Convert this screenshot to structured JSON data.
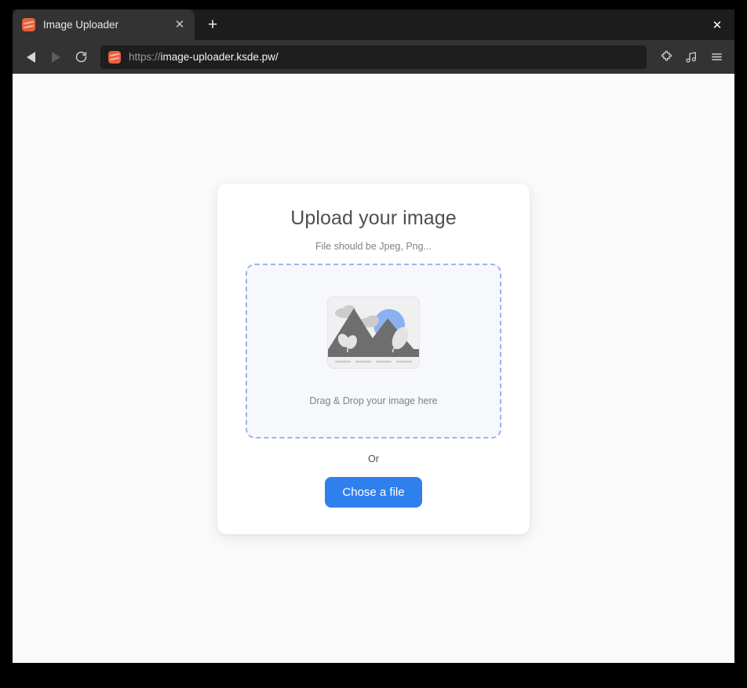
{
  "window": {
    "close_label": "✕"
  },
  "tabs": [
    {
      "title": "Image Uploader",
      "favicon_name": "image-uploader-favicon",
      "close_label": "✕"
    }
  ],
  "new_tab": {
    "label": "+"
  },
  "toolbar": {
    "back_icon": "back-arrow-icon",
    "forward_icon": "forward-arrow-icon",
    "reload_icon": "reload-icon",
    "extensions_icon": "puzzle-piece-icon",
    "media_icon": "music-note-icon",
    "menu_icon": "hamburger-menu-icon"
  },
  "address_bar": {
    "scheme": "https://",
    "host_path": "image-uploader.ksde.pw/",
    "full_url": "https://image-uploader.ksde.pw/"
  },
  "page": {
    "card": {
      "title": "Upload your image",
      "subtitle": "File should be Jpeg, Png...",
      "dropzone": {
        "label": "Drag & Drop your image here",
        "illustration_name": "landscape-image-placeholder-icon"
      },
      "separator_text": "Or",
      "choose_file_label": "Chose a file"
    }
  },
  "colors": {
    "page_background": "#fafafa",
    "card_background": "#ffffff",
    "accent_blue": "#2f80ed",
    "dropzone_border": "#97b6f0",
    "dropzone_background": "#f6f8fb",
    "title_text": "#4f4f4f",
    "muted_text": "#828282",
    "favicon_orange": "#e8603c",
    "illustration_mountain": "#6e6e6e",
    "illustration_sun": "#8cb1f2",
    "illustration_cloud": "#cccccc",
    "browser_chrome": "#333333"
  }
}
